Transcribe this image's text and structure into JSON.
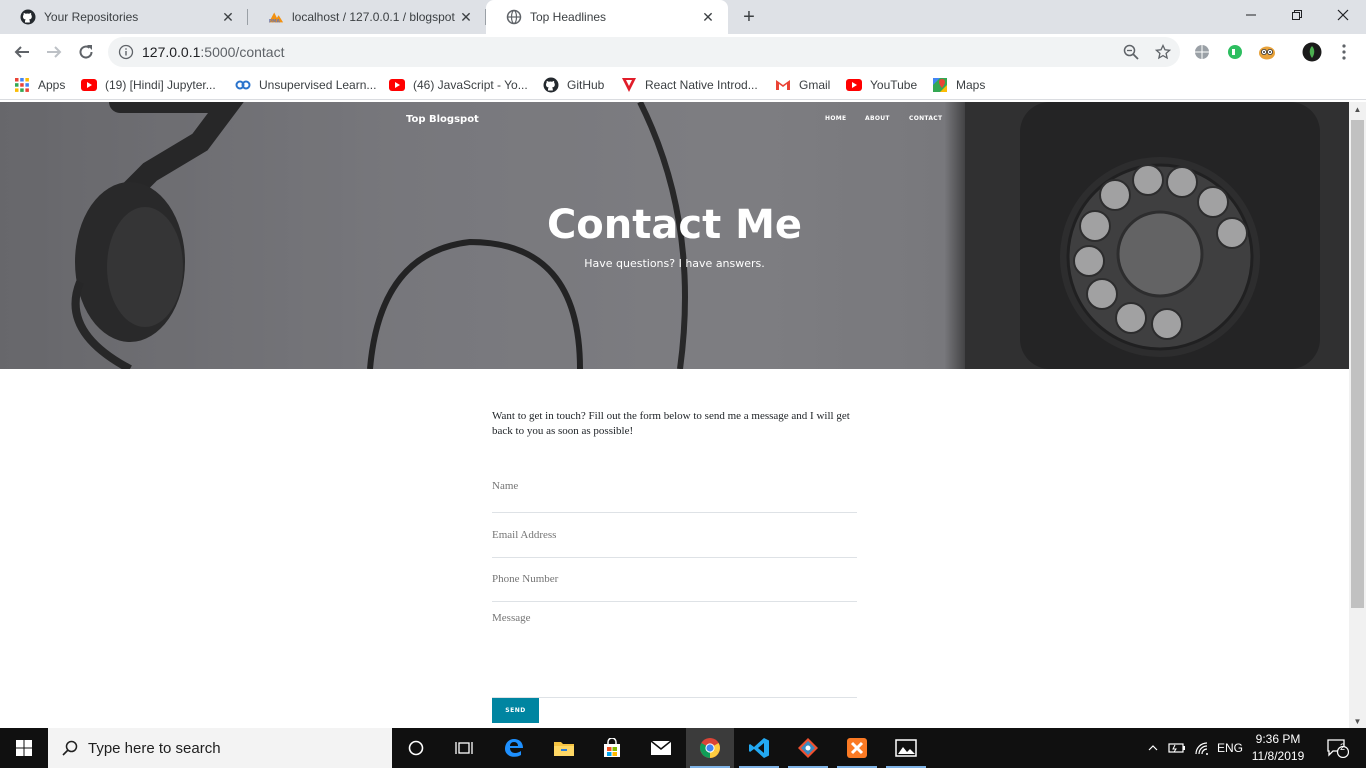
{
  "browser": {
    "tabs": [
      {
        "title": "Your Repositories",
        "icon": "github-icon",
        "active": false
      },
      {
        "title": "localhost / 127.0.0.1 / blogspot |",
        "icon": "phpmyadmin-icon",
        "active": false
      },
      {
        "title": "Top Headlines",
        "icon": "globe-icon",
        "active": true
      }
    ],
    "url_host": "127.0.0.1",
    "url_path": ":5000/contact"
  },
  "bookmarks": [
    {
      "label": "Apps",
      "icon": "apps-grid-icon"
    },
    {
      "label": "(19) [Hindi] Jupyter...",
      "icon": "youtube-icon"
    },
    {
      "label": "Unsupervised Learn...",
      "icon": "coursera-icon"
    },
    {
      "label": "(46) JavaScript - Yo...",
      "icon": "youtube-icon"
    },
    {
      "label": "GitHub",
      "icon": "github-icon"
    },
    {
      "label": "React Native Introd...",
      "icon": "tutorialspoint-icon"
    },
    {
      "label": "Gmail",
      "icon": "gmail-icon"
    },
    {
      "label": "YouTube",
      "icon": "youtube-icon"
    },
    {
      "label": "Maps",
      "icon": "maps-icon"
    }
  ],
  "site": {
    "brand": "Top Blogspot",
    "nav": [
      "HOME",
      "ABOUT",
      "CONTACT"
    ],
    "hero_title": "Contact Me",
    "hero_subtitle": "Have questions? I have answers.",
    "intro": "Want to get in touch? Fill out the form below to send me a message and I will get back to you as soon as possible!",
    "fields": {
      "name_placeholder": "Name",
      "email_placeholder": "Email Address",
      "phone_placeholder": "Phone Number",
      "message_placeholder": "Message"
    },
    "send_label": "SEND"
  },
  "taskbar": {
    "search_placeholder": "Type here to search",
    "language": "ENG",
    "time": "9:36 PM",
    "date": "11/8/2019",
    "notification_count": "2"
  },
  "colors": {
    "accent": "#0085a1",
    "taskbar": "#101010",
    "tabstrip": "#dee1e6"
  }
}
